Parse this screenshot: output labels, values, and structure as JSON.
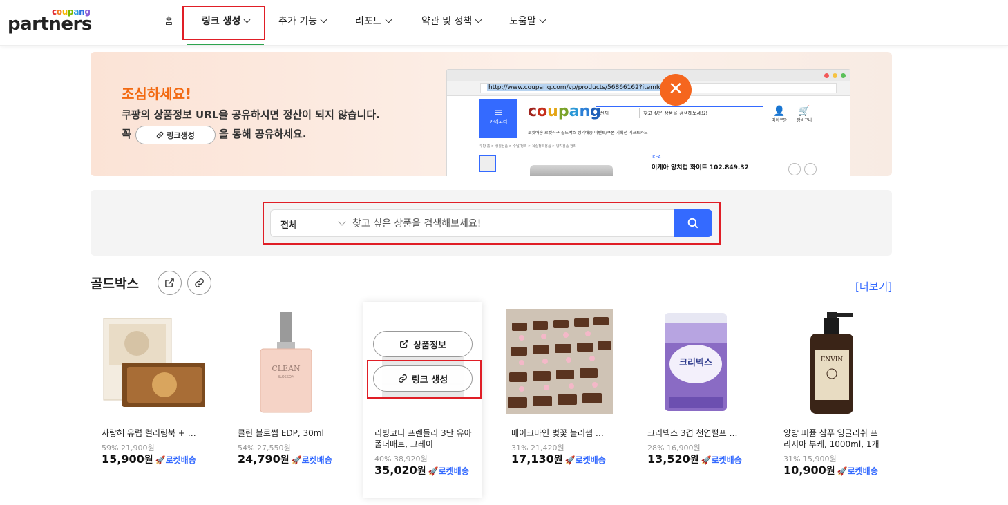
{
  "header": {
    "logo_small": "coupang",
    "logo_big": "partners",
    "nav": [
      {
        "label": "홈"
      },
      {
        "label": "링크 생성"
      },
      {
        "label": "추가 기능"
      },
      {
        "label": "리포트"
      },
      {
        "label": "약관 및 정책"
      },
      {
        "label": "도움말"
      }
    ]
  },
  "banner": {
    "title": "조심하세요!",
    "line1": "쿠팡의 상품정보 URL을 공유하시면 정산이 되지 않습니다.",
    "line2_pre": "꼭",
    "pill_label": "링크생성",
    "line2_post": "을 통해 공유하세요.",
    "mock": {
      "url": "http://www.coupang.com/vp/products/56866162?itemId",
      "category_label": "카테고리",
      "logo": "coupang",
      "search_scope": "전체",
      "search_placeholder": "찾고 싶은 상품을 검색해보세요!",
      "menu": "로켓배송   로켓직구   골드박스   정기배송   이벤트/쿠폰   기획전   기프트카드",
      "crumb": "쿠팡 홈 >  생활용품 >  수납/정리 >  욕실정리용품 >  양치용품 정리",
      "my_label": "마이쿠팡",
      "cart_label": "장바구니",
      "brand": "IKEA",
      "product": "이케아 양치컵 화이트 102.849.32"
    }
  },
  "search": {
    "category": "전체",
    "placeholder": "찾고 싶은 상품을 검색해보세요!"
  },
  "goldbox": {
    "title": "골드박스",
    "more": "[더보기]",
    "hover_info": "상품정보",
    "hover_link": "링크 생성",
    "rocket": "로켓배송",
    "products": [
      {
        "name": "사랑혜 유럽 컬러링북 + 아…",
        "discount": "59%",
        "original": "21,900원",
        "price": "15,900",
        "unit": "원"
      },
      {
        "name": "클린 블로썸 EDP, 30ml",
        "discount": "54%",
        "original": "27,550원",
        "price": "24,790",
        "unit": "원"
      },
      {
        "name": "리빙코디 프렌들리 3단 유아폴더매트, 그레이",
        "discount": "40%",
        "original": "38,920원",
        "price": "35,020",
        "unit": "원"
      },
      {
        "name": "메이크마인 벚꽃 블러썸 파…",
        "discount": "31%",
        "original": "21,420원",
        "price": "17,130",
        "unit": "원"
      },
      {
        "name": "크리넥스 3겹 천연펄프 순…",
        "discount": "28%",
        "original": "16,900원",
        "price": "13,520",
        "unit": "원"
      },
      {
        "name": "양방 퍼퓸 샴푸 잉글리쉬 프리지아 부케, 1000ml, 1개",
        "discount": "31%",
        "original": "15,900원",
        "price": "10,900",
        "unit": "원"
      }
    ]
  },
  "colors": {
    "accent": "#346aff",
    "warning": "#f26a12",
    "highlight": "#e01e26"
  }
}
